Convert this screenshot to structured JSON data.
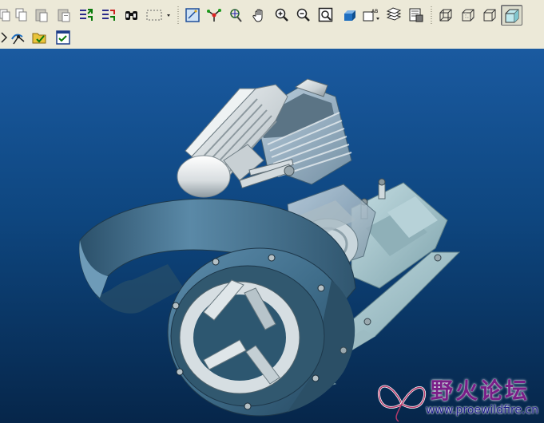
{
  "toolbar": {
    "row1": [
      {
        "id": "copy-icon"
      },
      {
        "id": "paste-icon"
      },
      {
        "id": "paste-special-icon"
      },
      {
        "id": "regenerate-icon"
      },
      {
        "id": "regenerate-manager-icon"
      },
      {
        "id": "search-tool-icon"
      },
      {
        "id": "selection-box-icon"
      },
      {
        "id": "repaint-icon"
      },
      {
        "id": "spin-center-icon"
      },
      {
        "id": "orient-mode-icon"
      },
      {
        "id": "pan-hand-icon"
      },
      {
        "id": "zoom-in-icon"
      },
      {
        "id": "zoom-out-icon"
      },
      {
        "id": "refit-icon"
      },
      {
        "id": "reorient-icon"
      },
      {
        "id": "saved-views-icon"
      },
      {
        "id": "layers-icon"
      },
      {
        "id": "view-manager-icon"
      },
      {
        "id": "wireframe-icon"
      },
      {
        "id": "hidden-line-icon"
      },
      {
        "id": "no-hidden-icon"
      },
      {
        "id": "shading-icon",
        "pressed": true
      }
    ],
    "row2": [
      {
        "id": "datum-display-icon"
      },
      {
        "id": "analysis-icon"
      },
      {
        "id": "folder-checked-icon"
      },
      {
        "id": "checklist-icon"
      }
    ]
  },
  "viewport": {
    "content": "3D shaded engine assembly model"
  },
  "watermark": {
    "title_cn": "野火论坛",
    "url": "www.proewildfire.cn"
  },
  "colors": {
    "toolbar_bg": "#ece9d8",
    "viewport_top": "#1a5aa0",
    "viewport_bottom": "#06264a",
    "model_body": "#3f6d8a",
    "model_metal": "#d6dde1"
  }
}
